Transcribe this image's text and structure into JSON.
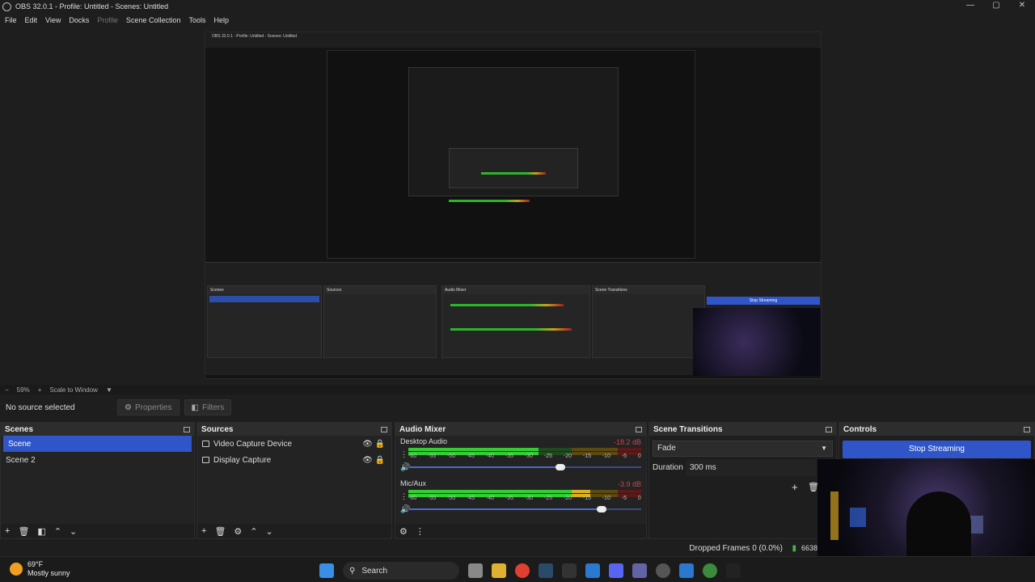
{
  "window": {
    "title": "OBS 32.0.1 - Profile: Untitled - Scenes: Untitled",
    "controls": [
      "—",
      "▢",
      "✕"
    ]
  },
  "menu": [
    "File",
    "Edit",
    "View",
    "Docks",
    "Profile",
    "Scene Collection",
    "Tools",
    "Help"
  ],
  "zoom": {
    "minus": "−",
    "value": "59%",
    "plus": "+",
    "mode": "Scale to Window",
    "caret": "▼"
  },
  "source_toolbar": {
    "no_source": "No source selected",
    "properties": "Properties",
    "filters": "Filters"
  },
  "scenes": {
    "title": "Scenes",
    "items": [
      "Scene",
      "Scene 2"
    ],
    "selected": 0
  },
  "sources": {
    "title": "Sources",
    "items": [
      {
        "label": "Video Capture Device",
        "icon": "camera-icon"
      },
      {
        "label": "Display Capture",
        "icon": "monitor-icon"
      }
    ]
  },
  "audio_mixer": {
    "title": "Audio Mixer",
    "channels": [
      {
        "name": "Desktop Audio",
        "db": "-18.2 dB",
        "level": 0.56,
        "volume": 0.65
      },
      {
        "name": "Mic/Aux",
        "db": "-3.9 dB",
        "level": 0.78,
        "volume": 0.83
      }
    ],
    "ticks": [
      "-60",
      "-55",
      "-50",
      "-45",
      "-40",
      "-35",
      "-30",
      "-25",
      "-20",
      "-15",
      "-10",
      "-5",
      "0"
    ]
  },
  "transitions": {
    "title": "Scene Transitions",
    "selected": "Fade",
    "duration_label": "Duration",
    "duration_value": "300 ms"
  },
  "controls": {
    "title": "Controls",
    "stop_streaming": "Stop Streaming"
  },
  "status": {
    "dropped": "Dropped Frames 0 (0.0%)",
    "count": "6638"
  },
  "taskbar": {
    "temp": "69°F",
    "condition": "Mostly sunny",
    "search": "Search"
  }
}
